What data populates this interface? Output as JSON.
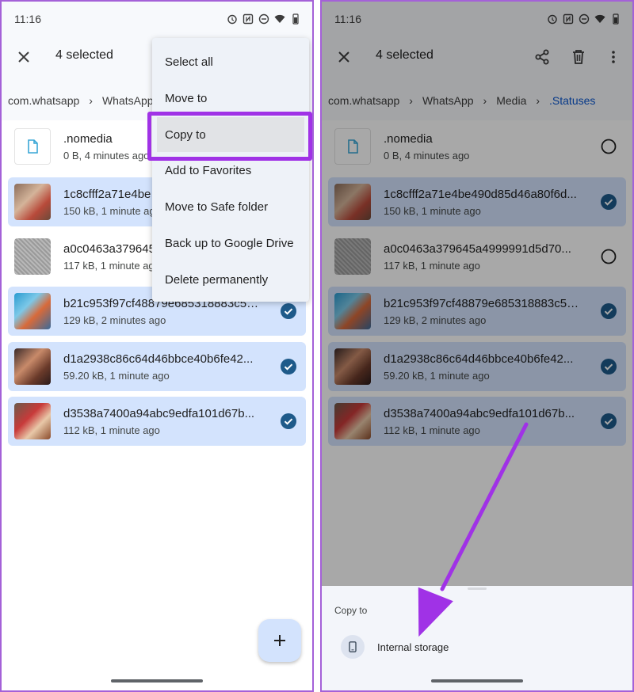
{
  "colors": {
    "accent": "#a032e6",
    "selected_row": "#d3e3fd",
    "check_blue": "#1e5a8a",
    "breadcrumb_active": "#0b57d0"
  },
  "left": {
    "status": {
      "time": "11:16"
    },
    "toolbar": {
      "selected_count": "4 selected"
    },
    "breadcrumb": [
      "com.whatsapp",
      "WhatsApp"
    ],
    "menu": {
      "items": [
        "Select all",
        "Move to",
        "Copy to",
        "Add to Favorites",
        "Move to Safe folder",
        "Back up to Google Drive",
        "Delete permanently"
      ]
    },
    "files": [
      {
        "name": ".nomedia",
        "meta": "0 B, 4 minutes ago",
        "selected": false
      },
      {
        "name": "1c8cfff2a71e4be",
        "meta": "150 kB, 1 minute ago",
        "selected": true
      },
      {
        "name": "a0c0463a379645",
        "meta": "117 kB, 1 minute ago",
        "selected": false
      },
      {
        "name": "b21c953f97cf48879e685318883c5c...",
        "meta": "129 kB, 2 minutes ago",
        "selected": true
      },
      {
        "name": "d1a2938c86c64d46bbce40b6fe42...",
        "meta": "59.20 kB, 1 minute ago",
        "selected": true
      },
      {
        "name": "d3538a7400a94abc9edfa101d67b...",
        "meta": "112 kB, 1 minute ago",
        "selected": true
      }
    ]
  },
  "right": {
    "status": {
      "time": "11:16"
    },
    "toolbar": {
      "selected_count": "4 selected"
    },
    "breadcrumb": [
      "com.whatsapp",
      "WhatsApp",
      "Media",
      ".Statuses"
    ],
    "files": [
      {
        "name": ".nomedia",
        "meta": "0 B, 4 minutes ago",
        "selected": false
      },
      {
        "name": "1c8cfff2a71e4be490d85d46a80f6d...",
        "meta": "150 kB, 1 minute ago",
        "selected": true
      },
      {
        "name": "a0c0463a379645a4999991d5d70...",
        "meta": "117 kB, 1 minute ago",
        "selected": false
      },
      {
        "name": "b21c953f97cf48879e685318883c5c...",
        "meta": "129 kB, 2 minutes ago",
        "selected": true
      },
      {
        "name": "d1a2938c86c64d46bbce40b6fe42...",
        "meta": "59.20 kB, 1 minute ago",
        "selected": true
      },
      {
        "name": "d3538a7400a94abc9edfa101d67b...",
        "meta": "112 kB, 1 minute ago",
        "selected": true
      }
    ],
    "sheet": {
      "title": "Copy to",
      "storage_label": "Internal storage"
    }
  }
}
